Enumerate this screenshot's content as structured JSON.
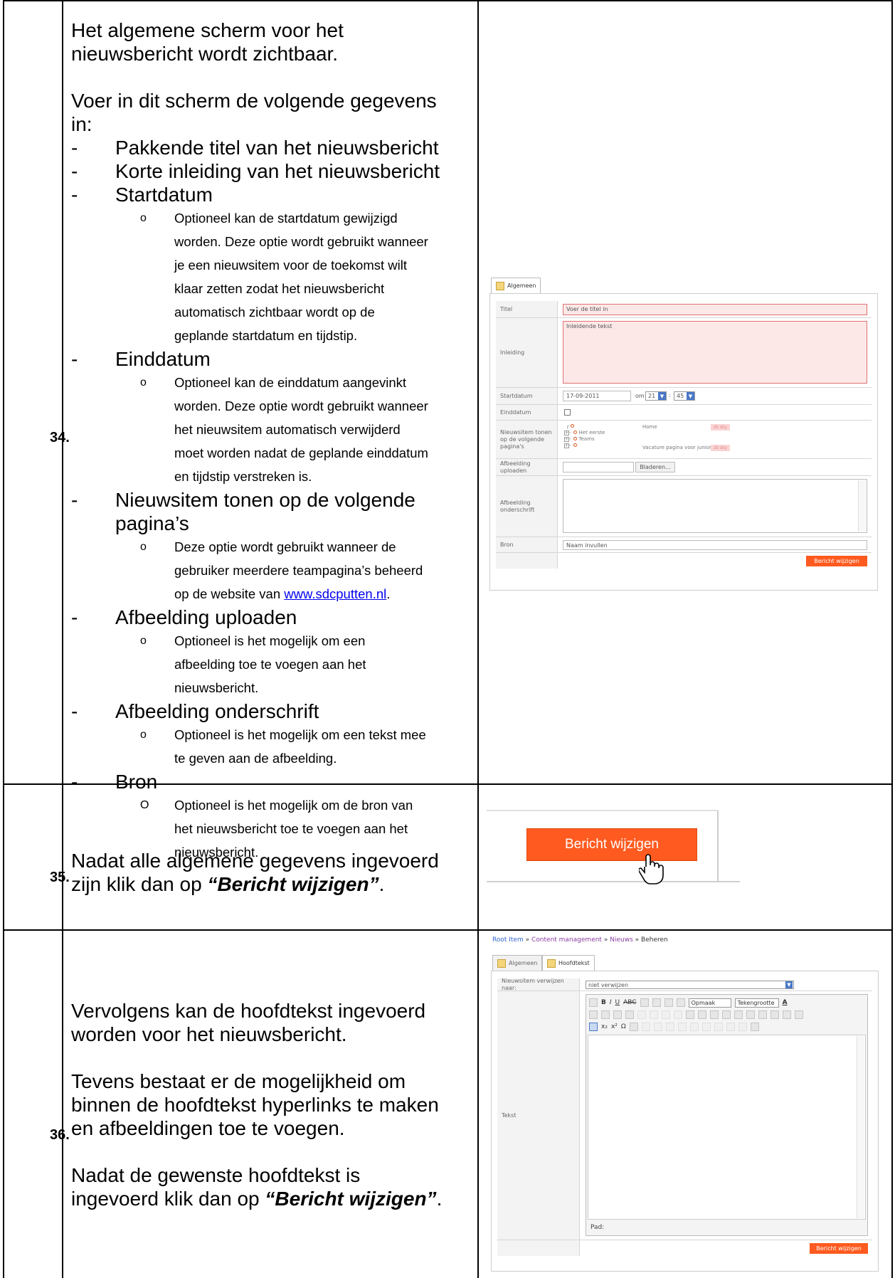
{
  "rows": [
    {
      "number": "34.",
      "intro": [
        "Het algemene scherm voor het",
        "nieuwsbericht wordt zichtbaar."
      ],
      "instruction": [
        "Voer in dit scherm de volgende gegevens",
        "in:"
      ],
      "items": [
        {
          "dash": "-",
          "text": "Pakkende titel van het nieuwsbericht"
        },
        {
          "dash": "-",
          "text": "Korte inleiding van het nieuwsbericht"
        },
        {
          "dash": "-",
          "text": "Startdatum",
          "sub": {
            "marker": "o",
            "lines": [
              "Optioneel kan de startdatum gewijzigd",
              "worden. Deze optie wordt gebruikt wanneer",
              "je een nieuwsitem voor de toekomst wilt",
              "klaar zetten zodat het nieuwsbericht",
              "automatisch zichtbaar wordt op de",
              "geplande startdatum en tijdstip."
            ]
          }
        },
        {
          "dash": "-",
          "text": "Einddatum",
          "sub": {
            "marker": "o",
            "lines": [
              "Optioneel kan de einddatum aangevinkt",
              "worden. Deze optie wordt gebruikt wanneer",
              "het nieuwsitem automatisch verwijderd",
              "moet worden nadat de geplande einddatum",
              "en tijdstip verstreken is."
            ]
          }
        },
        {
          "dash": "-",
          "text": "Nieuwsitem tonen op de volgende",
          "text2": "pagina’s",
          "sub": {
            "marker": "o",
            "lines": [
              "Deze optie wordt gebruikt wanneer de",
              "gebruiker meerdere teampagina’s beheerd"
            ],
            "last_prefix": "op de website van ",
            "link": "www.sdcputten.nl",
            "last_suffix": "."
          }
        },
        {
          "dash": "-",
          "text": "Afbeelding uploaden",
          "sub": {
            "marker": "o",
            "lines": [
              "Optioneel is het mogelijk om een",
              "afbeelding toe te voegen aan het",
              "nieuwsbericht."
            ]
          }
        },
        {
          "dash": "-",
          "text": "Afbeelding onderschrift",
          "sub": {
            "marker": "o",
            "lines": [
              "Optioneel is het mogelijk om een tekst mee",
              "te geven aan de afbeelding."
            ]
          }
        },
        {
          "dash": "-",
          "text": "Bron",
          "sub": {
            "marker": "O",
            "lines": [
              "Optioneel is het mogelijk om de bron van",
              "het nieuwsbericht toe te voegen aan het",
              "nieuwsbericht."
            ]
          }
        }
      ]
    },
    {
      "number": "35.",
      "line1": "Nadat alle algemene gegevens ingevoerd",
      "line2_prefix": "zijn klik dan op ",
      "line2_emph": "“Bericht wijzigen”",
      "line2_suffix": "."
    },
    {
      "number": "36.",
      "p1": [
        "Vervolgens kan de hoofdtekst ingevoerd",
        "worden voor het nieuwsbericht."
      ],
      "p2": [
        "Tevens bestaat er de mogelijkheid om",
        "binnen de hoofdtekst hyperlinks te maken",
        "en afbeeldingen toe te voegen."
      ],
      "p3_line1": "Nadat de gewenste hoofdtekst is",
      "p3_prefix": "ingevoerd klik dan op ",
      "p3_emph": "“Bericht wijzigen”",
      "p3_suffix": "."
    }
  ],
  "form1": {
    "tab": "Algemeen",
    "labels": {
      "titel": "Titel",
      "inleiding": "Inleiding",
      "startdatum": "Startdatum",
      "einddatum": "Einddatum",
      "paginas": "Nieuwsitem tonen op de volgende pagina's",
      "upload": "Afbeelding uploaden",
      "onderschrift": "Afbeelding onderschrift",
      "bron": "Bron"
    },
    "titel_placeholder": "Voer de titel in",
    "inleiding_placeholder": "Inleidende tekst",
    "start_date": "17-09-2011",
    "om": "om",
    "hour": "21",
    "minute": "45",
    "tree_home": "Home",
    "tree_eerste": "Het eerste",
    "tree_teams": "Teams",
    "tree_vacature": "Vacature pagina voor junioren",
    "tree_tag": "zb sky",
    "browse": "Bladeren...",
    "bron_placeholder": "Naam invullen",
    "submit": "Bericht wijzigen"
  },
  "button_zoom": {
    "label": "Bericht wijzigen"
  },
  "form2": {
    "breadcrumb": {
      "root": "Root Item",
      "sep": "»",
      "cm": "Content management",
      "news": "Nieuws",
      "current": "Beheren"
    },
    "tab1": "Algemeen",
    "tab2": "Hoofdtekst",
    "remove_label": "Nieuwsitem verwijzen naar:",
    "remove_value": "niet verwijzen",
    "text_label": "Tekst",
    "format_select": "Opmaak",
    "size_select": "Tekengrootte",
    "path": "Pad:",
    "submit": "Bericht wijzigen"
  }
}
